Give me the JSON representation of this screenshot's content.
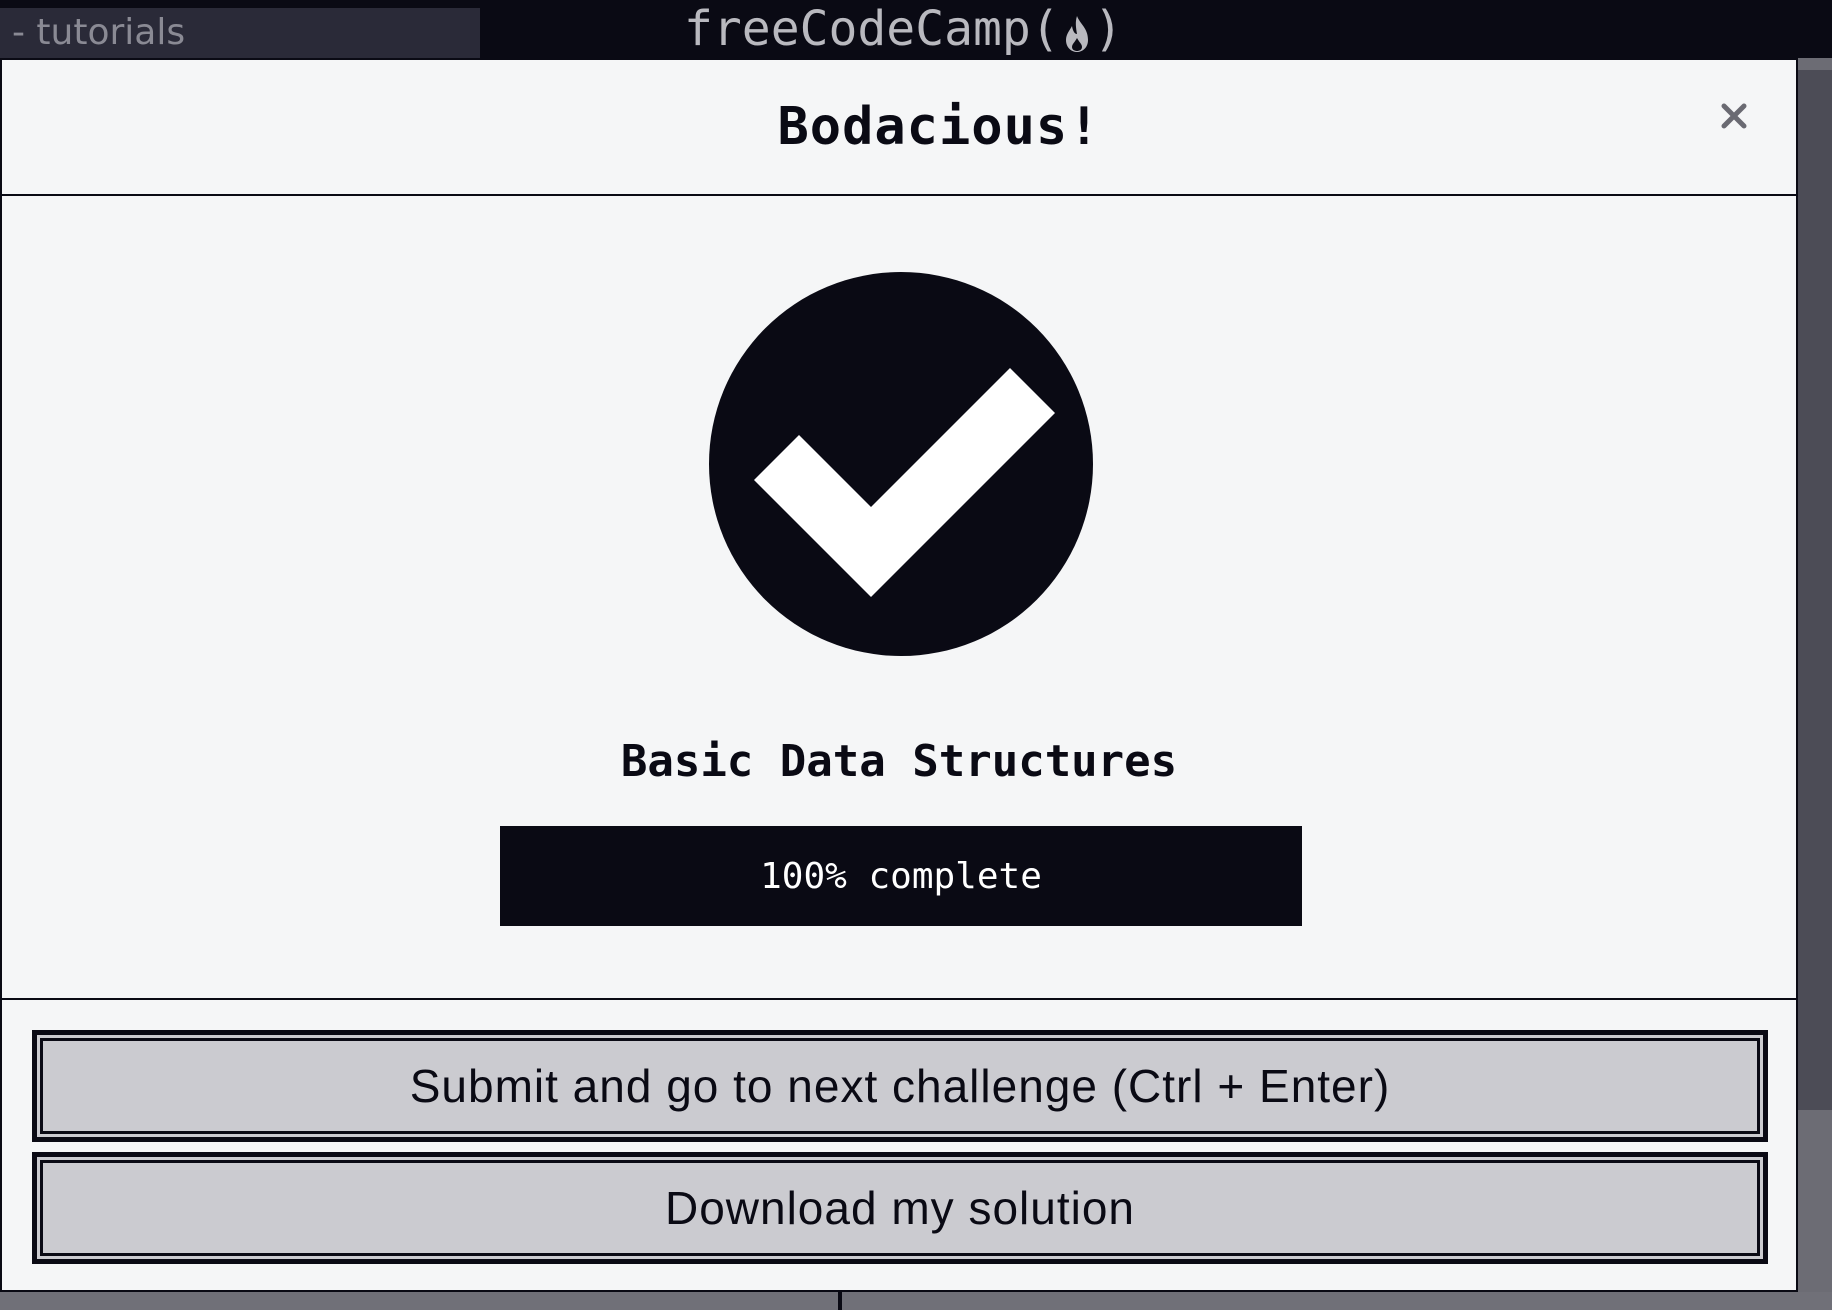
{
  "background": {
    "search_text": "- tutorials",
    "brand": {
      "prefix": "freeCodeCamp(",
      "suffix": ")",
      "icon": "fire-icon"
    }
  },
  "modal": {
    "title": "Bodacious!",
    "close_icon": "close-icon",
    "success_icon": "check-circle-icon",
    "challenge_block_title": "Basic Data Structures",
    "progress": {
      "value_percent": 100,
      "label": "100% complete"
    },
    "buttons": {
      "submit_label": "Submit and go to next challenge (Ctrl + Enter)",
      "download_label": "Download my solution"
    }
  },
  "colors": {
    "primary_dark": "#0a0a14",
    "modal_bg": "#f5f6f7",
    "button_bg": "#cbcbd0"
  }
}
